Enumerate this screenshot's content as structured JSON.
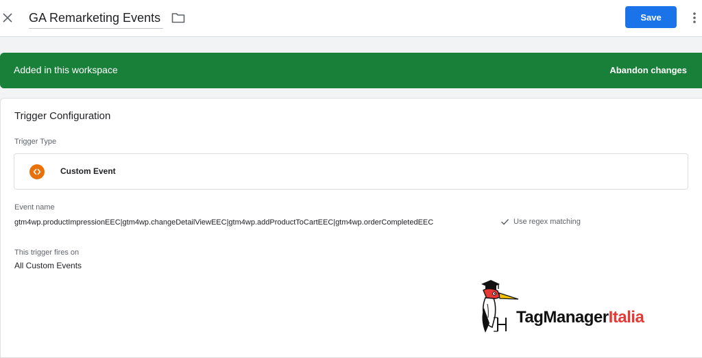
{
  "header": {
    "title": "GA Remarketing Events",
    "save_label": "Save",
    "close_icon": "close-icon",
    "folder_icon": "folder-icon",
    "more_icon": "more-vert-icon"
  },
  "banner": {
    "status_text": "Added in this workspace",
    "action_label": "Abandon changes",
    "color": "#188038"
  },
  "trigger": {
    "section_title": "Trigger Configuration",
    "type_label": "Trigger Type",
    "type_name": "Custom Event",
    "type_icon": "code-brackets-icon",
    "type_icon_color": "#e8710a",
    "event_name_label": "Event name",
    "event_name_value": "gtm4wp.productImpressionEEC|gtm4wp.changeDetailViewEEC|gtm4wp.addProductToCartEEC|gtm4wp.orderCompletedEEC",
    "regex_label": "Use regex matching",
    "fires_on_label": "This trigger fires on",
    "fires_on_value": "All Custom Events"
  },
  "logo": {
    "brand_main": "TagManager",
    "brand_accent": "Italia"
  },
  "colors": {
    "primary": "#1a73e8",
    "success": "#188038",
    "accent_orange": "#e8710a"
  }
}
